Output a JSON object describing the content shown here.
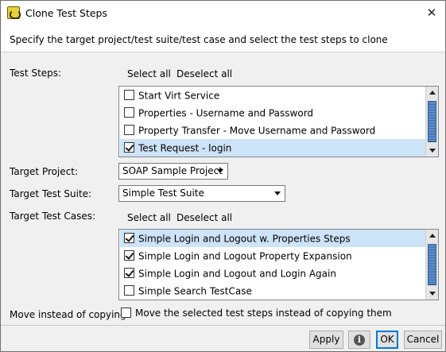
{
  "window": {
    "title": "Clone Test Steps",
    "close_glyph": "✕"
  },
  "instruction": "Specify the target project/test suite/test case and select the test steps to clone",
  "test_steps": {
    "label": "Test Steps:",
    "select_all": "Select all",
    "deselect_all": "Deselect all",
    "items": [
      {
        "label": "Start Virt Service",
        "checked": false,
        "selected": false
      },
      {
        "label": "Properties - Username and Password",
        "checked": false,
        "selected": false
      },
      {
        "label": "Property Transfer - Move Username and Password",
        "checked": false,
        "selected": false
      },
      {
        "label": "Test Request - login",
        "checked": true,
        "selected": true
      }
    ]
  },
  "target_project": {
    "label": "Target Project:",
    "value": "SOAP Sample Project"
  },
  "target_test_suite": {
    "label": "Target Test Suite:",
    "value": "Simple Test Suite"
  },
  "target_test_cases": {
    "label": "Target Test Cases:",
    "select_all": "Select all",
    "deselect_all": "Deselect all",
    "items": [
      {
        "label": "Simple Login and Logout w. Properties Steps",
        "checked": true,
        "selected": true
      },
      {
        "label": "Simple Login and Logout Property Expansion",
        "checked": true,
        "selected": false
      },
      {
        "label": "Simple Login and Logout and Login Again",
        "checked": true,
        "selected": false
      },
      {
        "label": "Simple Search TestCase",
        "checked": false,
        "selected": false
      }
    ]
  },
  "move": {
    "label": "Move instead of copying:",
    "checkbox_label": "Move the selected test steps instead of copying them",
    "checked": false
  },
  "buttons": {
    "apply": "Apply",
    "info_icon": "info-icon",
    "ok": "OK",
    "cancel": "Cancel"
  },
  "colors": {
    "selection": "#cde3f7",
    "scroll_thumb": "#4a7fc0",
    "ok_border": "#0078d7"
  }
}
